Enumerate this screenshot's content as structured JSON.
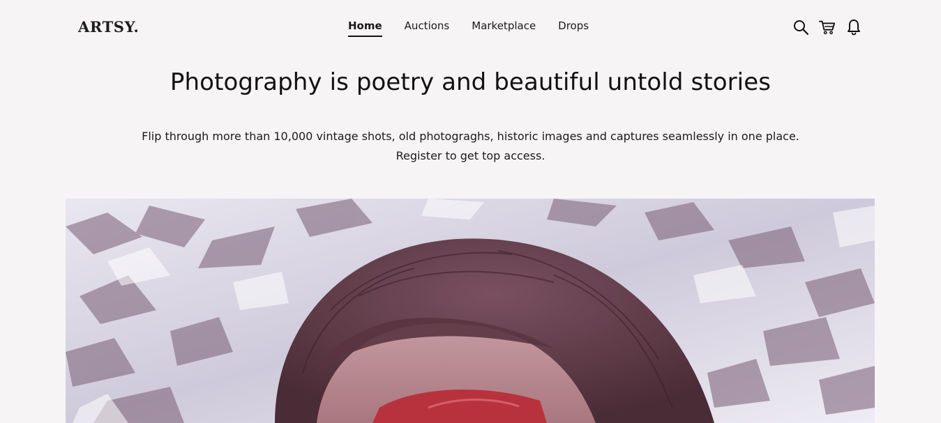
{
  "brand": {
    "logo": "ARTSY."
  },
  "nav": {
    "items": [
      {
        "label": "Home",
        "active": true
      },
      {
        "label": "Auctions",
        "active": false
      },
      {
        "label": "Marketplace",
        "active": false
      },
      {
        "label": "Drops",
        "active": false
      }
    ]
  },
  "header_icons": [
    "search-icon",
    "cart-icon",
    "bell-icon"
  ],
  "hero": {
    "title": "Photography is poetry and beautiful untold stories",
    "subtitle_line1": "Flip through more than 10,000 vintage shots, old photograghs, historic images and captures seamlessly in one place.",
    "subtitle_line2": "Register to get top access."
  },
  "colors": {
    "background": "#f6f4f5",
    "text": "#111111",
    "foil": "#d9d6e4",
    "hair": "#6b4450",
    "skin": "#b98a92",
    "glasses": "#b8323d"
  }
}
